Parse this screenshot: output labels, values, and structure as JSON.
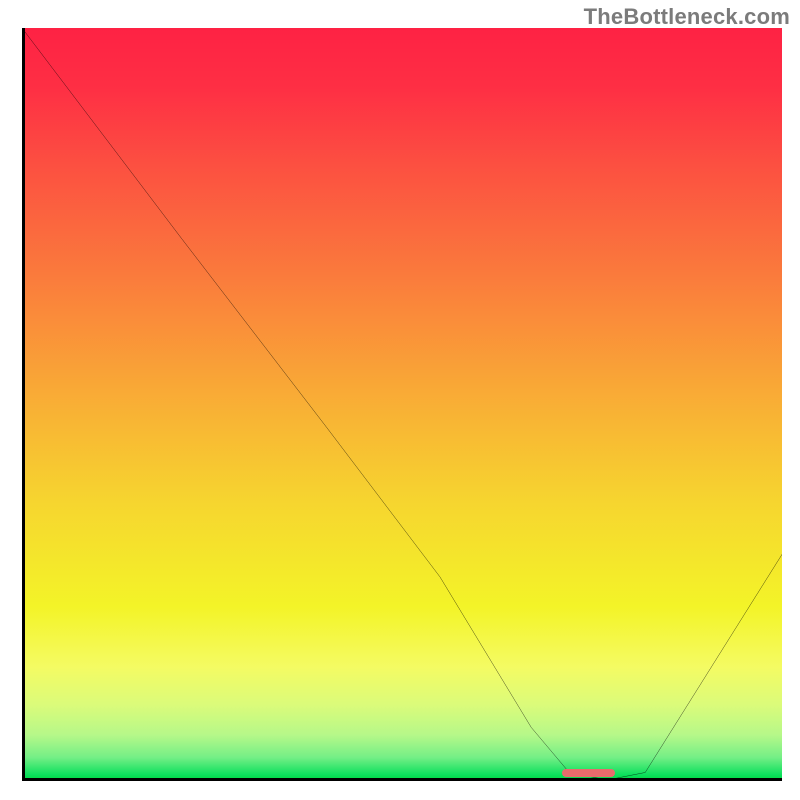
{
  "watermark": "TheBottleneck.com",
  "chart_data": {
    "type": "line",
    "title": "",
    "xlabel": "",
    "ylabel": "",
    "xlim": [
      0,
      100
    ],
    "ylim": [
      0,
      100
    ],
    "grid": false,
    "legend": false,
    "background": "heatmap-gradient",
    "gradient_stops": [
      {
        "pos": 0.0,
        "color": "#fe2244"
      },
      {
        "pos": 0.18,
        "color": "#fc4f41"
      },
      {
        "pos": 0.33,
        "color": "#fa7b3c"
      },
      {
        "pos": 0.48,
        "color": "#f9a936"
      },
      {
        "pos": 0.63,
        "color": "#f6d52f"
      },
      {
        "pos": 0.77,
        "color": "#f3f428"
      },
      {
        "pos": 0.9,
        "color": "#dbfb7a"
      },
      {
        "pos": 0.97,
        "color": "#74ef86"
      },
      {
        "pos": 1.0,
        "color": "#00d840"
      }
    ],
    "series": [
      {
        "name": "bottleneck-curve",
        "x": [
          0,
          21,
          40,
          55,
          67,
          72,
          77,
          82,
          100
        ],
        "y": [
          100,
          72,
          47,
          27,
          7,
          1,
          0,
          1,
          30
        ]
      }
    ],
    "marker": {
      "name": "optimal-range",
      "x_start": 71,
      "x_end": 78,
      "y": 0,
      "color": "#e86b6c"
    }
  }
}
